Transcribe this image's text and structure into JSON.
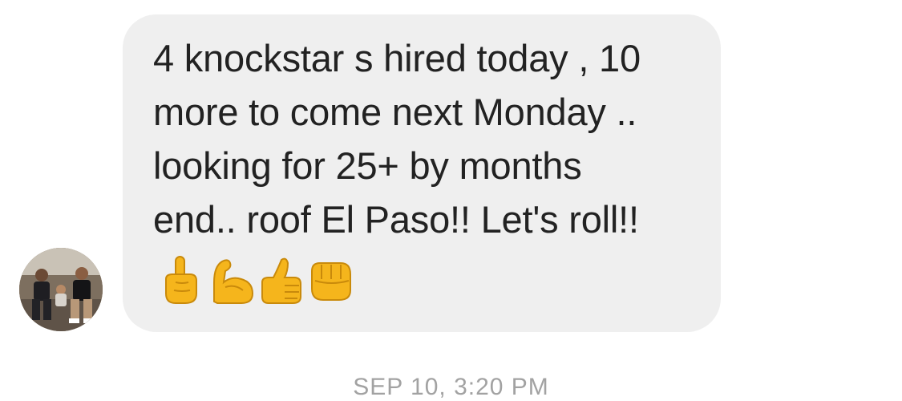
{
  "message": {
    "lines": [
      "4 knockstar s hired today , 10",
      "more to come next Monday ..",
      "looking for 25+ by months",
      "end.. roof El Paso!! Let's roll!!"
    ],
    "emojis": [
      "☝",
      "💪",
      "👍",
      "👊"
    ]
  },
  "avatar": {
    "icon": "sender-avatar-photo"
  },
  "timestamp": "SEP 10, 3:20 PM",
  "colors": {
    "bubble": "#efefef",
    "text": "#222222",
    "timestamp": "#a2a2a2",
    "emoji_yellow": "#f5b51c"
  }
}
